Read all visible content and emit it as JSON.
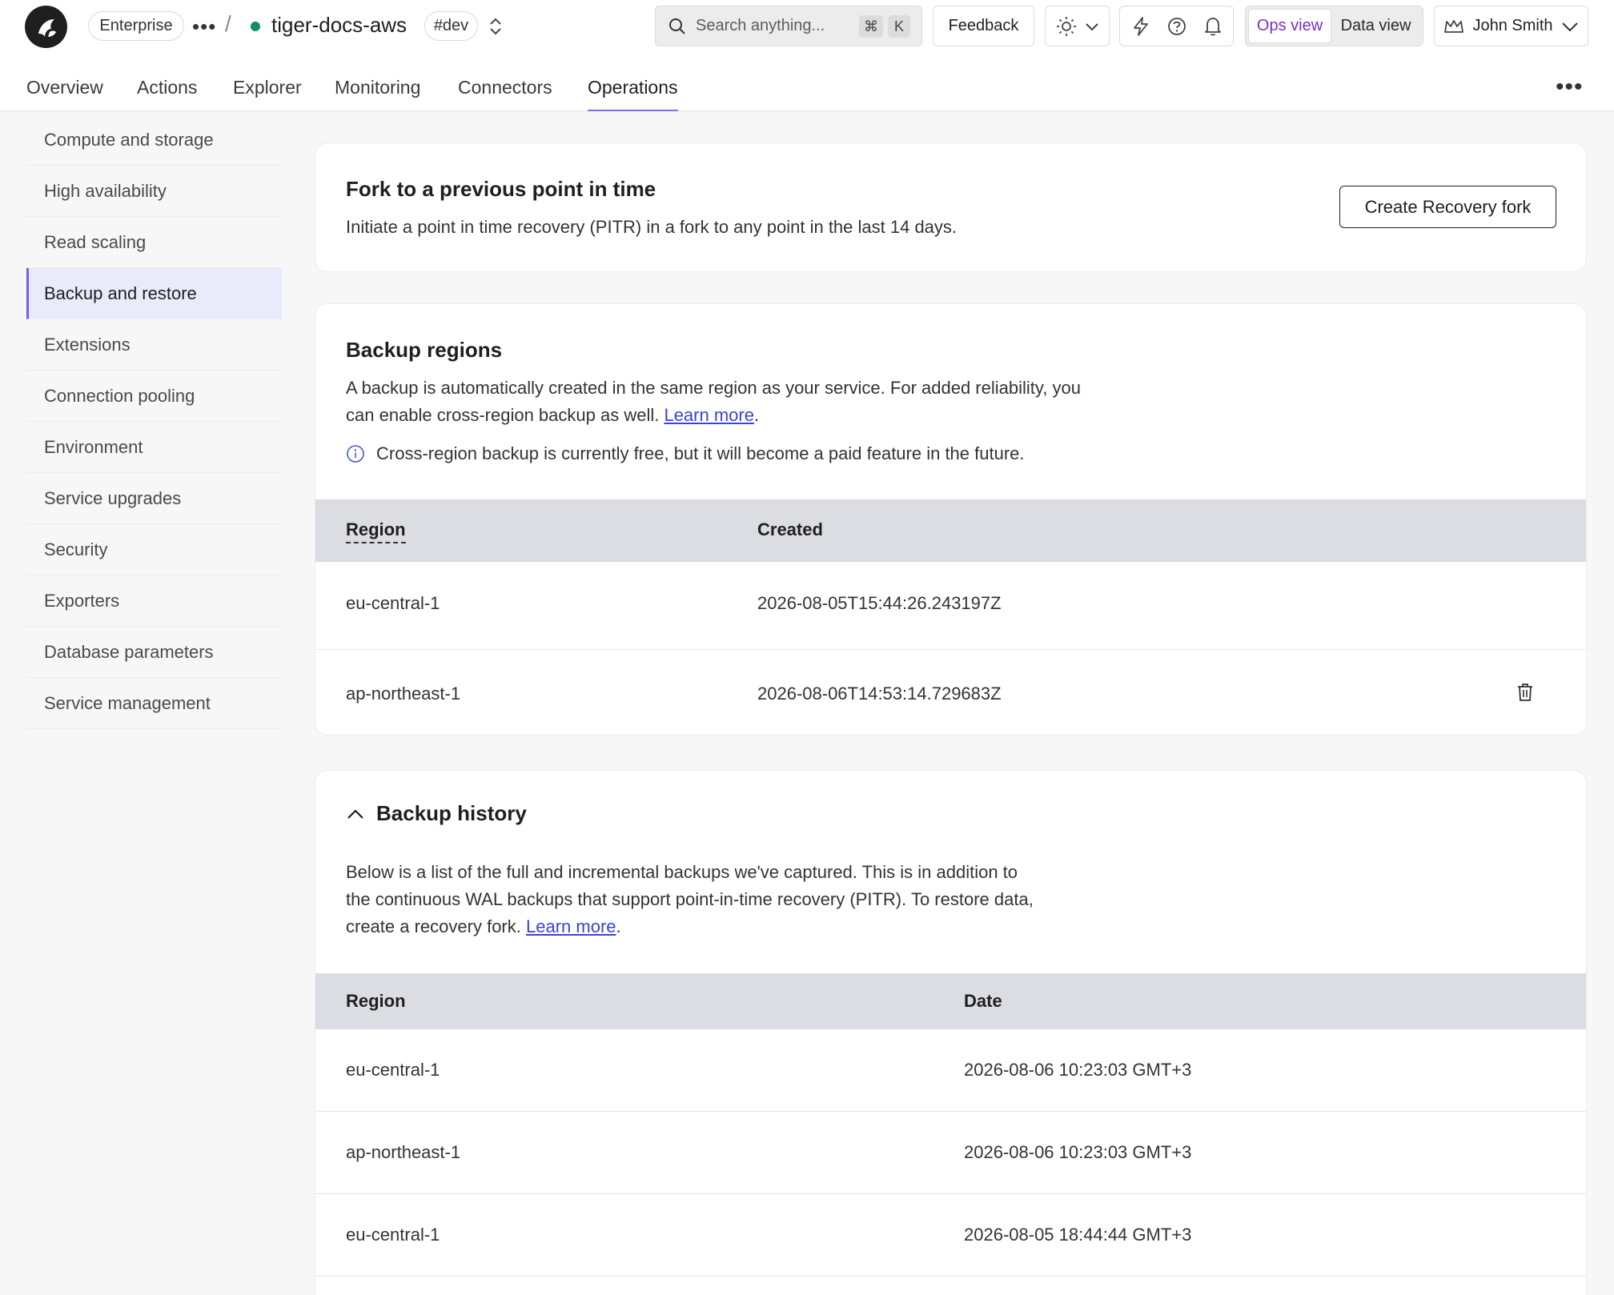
{
  "header": {
    "org_badge": "Enterprise",
    "service_name": "tiger-docs-aws",
    "env_badge": "#dev",
    "search": {
      "placeholder": "Search anything...",
      "shortcut_cmd": "⌘",
      "shortcut_key": "K"
    },
    "feedback_label": "Feedback",
    "view_toggle": {
      "ops": "Ops view",
      "data": "Data view"
    },
    "user_name": "John Smith"
  },
  "tabs": [
    {
      "label": "Overview"
    },
    {
      "label": "Actions"
    },
    {
      "label": "Explorer"
    },
    {
      "label": "Monitoring"
    },
    {
      "label": "Connectors"
    },
    {
      "label": "Operations"
    }
  ],
  "sidebar": {
    "items": [
      {
        "label": "Compute and storage"
      },
      {
        "label": "High availability"
      },
      {
        "label": "Read scaling"
      },
      {
        "label": "Backup and restore"
      },
      {
        "label": "Extensions"
      },
      {
        "label": "Connection pooling"
      },
      {
        "label": "Environment"
      },
      {
        "label": "Service upgrades"
      },
      {
        "label": "Security"
      },
      {
        "label": "Exporters"
      },
      {
        "label": "Database parameters"
      },
      {
        "label": "Service management"
      }
    ]
  },
  "fork": {
    "title": "Fork to a previous point in time",
    "description": "Initiate a point in time recovery (PITR) in a fork to any point in the last 14 days.",
    "button_label": "Create Recovery fork"
  },
  "regions": {
    "title": "Backup regions",
    "description_line1": "A backup is automatically created in the same region as your service. For added reliability, you",
    "description_line2": "can enable cross-region backup as well.",
    "learn_more": "Learn more",
    "info": "Cross-region backup is currently free, but it will become a paid feature in the future.",
    "columns": {
      "region": "Region",
      "created": "Created"
    },
    "rows": [
      {
        "region": "eu-central-1",
        "created": "2026-08-05T15:44:26.243197Z"
      },
      {
        "region": "ap-northeast-1",
        "created": "2026-08-06T14:53:14.729683Z"
      }
    ]
  },
  "history": {
    "title": "Backup history",
    "description_line1": "Below is a list of the full and incremental backups we've captured. This is in addition to",
    "description_line2": "the continuous WAL backups that support point-in-time recovery (PITR). To restore data,",
    "description_line3": "create a recovery fork.",
    "learn_more": "Learn more",
    "columns": {
      "region": "Region",
      "date": "Date"
    },
    "rows": [
      {
        "region": "eu-central-1",
        "date": "2026-08-06 10:23:03 GMT+3"
      },
      {
        "region": "ap-northeast-1",
        "date": "2026-08-06 10:23:03 GMT+3"
      },
      {
        "region": "eu-central-1",
        "date": "2026-08-05 18:44:44 GMT+3"
      }
    ]
  }
}
